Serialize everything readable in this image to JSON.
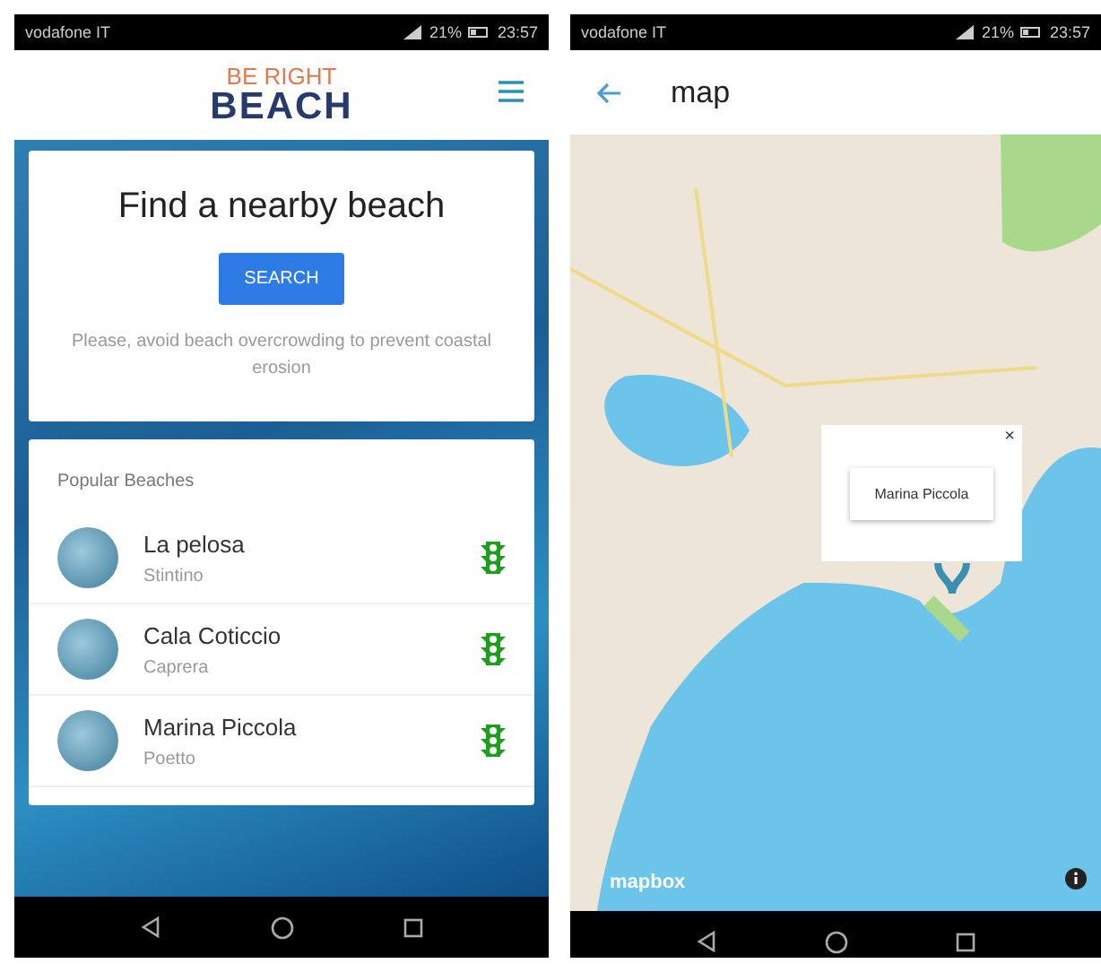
{
  "screens": [
    {
      "kind": "home",
      "status_bar": {
        "carrier": "vodafone IT",
        "battery": "21%",
        "time": "23:57"
      },
      "logo": {
        "top": "BE RIGHT",
        "bottom": "BEACH"
      },
      "search_card": {
        "title": "Find a nearby beach",
        "button": "SEARCH",
        "note": "Please, avoid beach overcrowding to prevent coastal erosion"
      },
      "popular": {
        "title": "Popular Beaches",
        "items": [
          {
            "name": "La pelosa",
            "place": "Stintino",
            "color": "#1e9e1e"
          },
          {
            "name": "Cala Coticcio",
            "place": "Caprera",
            "color": "#1e9e1e"
          },
          {
            "name": "Marina Piccola",
            "place": "Poetto",
            "color": "#1e9e1e"
          }
        ]
      }
    },
    {
      "kind": "map",
      "status_bar": {
        "carrier": "vodafone IT",
        "battery": "21%",
        "time": "23:57"
      },
      "title": "map",
      "popup": {
        "label": "Marina Piccola",
        "close": "×"
      },
      "attribution": "mapbox"
    }
  ]
}
